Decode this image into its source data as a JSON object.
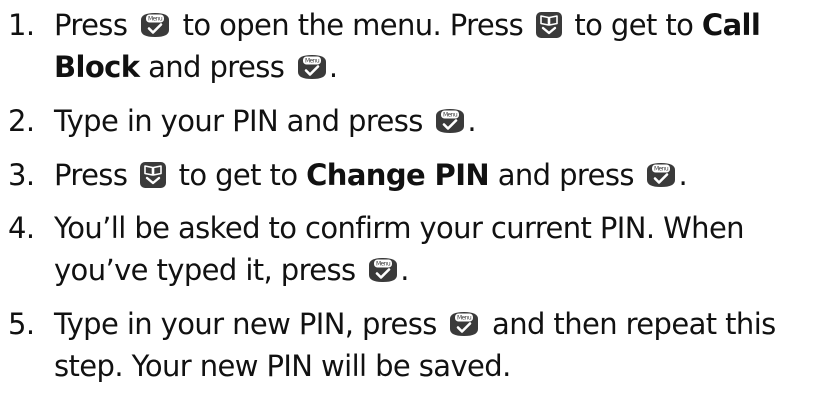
{
  "icons": {
    "menu_key": "menu-ok-key-icon",
    "menu_key_label": "Menu",
    "book_key": "phonebook-down-key-icon"
  },
  "colors": {
    "text": "#111111",
    "key_dark": "#3a3a3a",
    "key_light": "#ffffff"
  },
  "steps": [
    {
      "number": "1.",
      "t1": "Press",
      "t2": "to open the menu. Press",
      "t3": "to get to",
      "bold1": "Call",
      "bold2": "Block",
      "t4": "and press",
      "end": "."
    },
    {
      "number": "2.",
      "t1": "Type in your PIN and press",
      "end": "."
    },
    {
      "number": "3.",
      "t1": "Press",
      "t2": "to get to",
      "bold1": "Change PIN",
      "t3": "and press",
      "end": "."
    },
    {
      "number": "4.",
      "t1": "You’ll be asked to confirm your current PIN. When",
      "t2": "you’ve typed it, press",
      "end": "."
    },
    {
      "number": "5.",
      "t1": "Type in your new PIN, press",
      "t2": "and then repeat this",
      "t3": "step. Your new PIN will be saved."
    }
  ]
}
